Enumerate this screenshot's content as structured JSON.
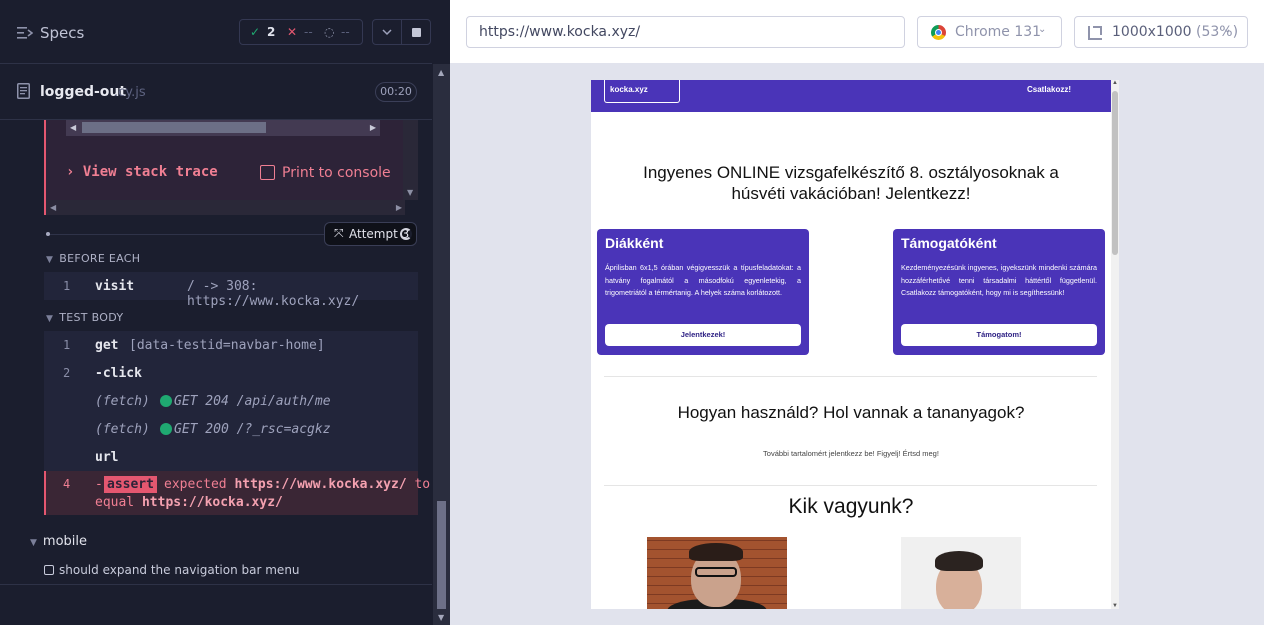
{
  "runner": {
    "specs_label": "Specs",
    "stats": {
      "passed_icon": "check-icon",
      "passed": "2",
      "failed_icon": "x-icon",
      "failed": "--",
      "pending_icon": "spinner-icon",
      "pending": "--"
    },
    "file": {
      "name": "logged-out",
      "ext": ".cy.js",
      "duration": "00:20"
    },
    "error": {
      "view_stack_trace": "› View stack trace",
      "print_to_console": "Print to console"
    },
    "attempt": "Attempt 3",
    "sections": {
      "before_each": "BEFORE EACH",
      "test_body": "TEST BODY"
    },
    "before_each_cmds": [
      {
        "num": "1",
        "name": "visit",
        "msg": "/ -> 308: https://www.kocka.xyz/"
      }
    ],
    "test_body_cmds": [
      {
        "num": "1",
        "name": "get",
        "msg": "[data-testid=navbar-home]"
      },
      {
        "num": "2",
        "name": "-click",
        "msg": ""
      },
      {
        "fetch": "(fetch)",
        "req": "GET 204 /api/auth/me"
      },
      {
        "fetch": "(fetch)",
        "req": "GET 200 /?_rsc=acgkz"
      },
      {
        "num": "",
        "name": "url",
        "msg": ""
      }
    ],
    "assert": {
      "num": "4",
      "tag": "assert",
      "l1_pre": "expected ",
      "l1_url": "https://www.kocka.xyz/",
      "l1_post": " to",
      "l2_pre": "equal ",
      "l2_url": "https://kocka.xyz/"
    },
    "suite": "mobile",
    "test": "should expand the navigation bar menu"
  },
  "browser": {
    "url": "https://www.kocka.xyz/",
    "browser_name": "Chrome 131",
    "viewport": "1000x1000",
    "zoom": "(53%)"
  },
  "site": {
    "brand": "kocka.xyz",
    "join": "Csatlakozz!",
    "hero": "Ingyenes ONLINE vizsgafelkészítő 8. osztályosoknak a húsvéti vakációban! Jelentkezz!",
    "cards": [
      {
        "title": "Diákként",
        "body": "Áprilisban 6x1,5 órában végigvesszük a típusfeladatokat: a hatvány fogalmától a másodfokú egyenletekig, a trigometriától a térmértanig. A helyek száma korlátozott.",
        "button": "Jelentkezek!"
      },
      {
        "title": "Támogatóként",
        "body": "Kezdeményezésünk ingyenes, igyekszünk mindenki számára hozzáférhetővé tenni társadalmi háttértől függetlenül. Csatlakozz támogatóként, hogy mi is segíthessünk!",
        "button": "Támogatom!"
      }
    ],
    "how_title": "Hogyan használd? Hol vannak a tananyagok?",
    "how_sub": "További tartalomért jelentkezz be! Figyelj! Értsd meg!",
    "who_title": "Kik vagyunk?"
  }
}
